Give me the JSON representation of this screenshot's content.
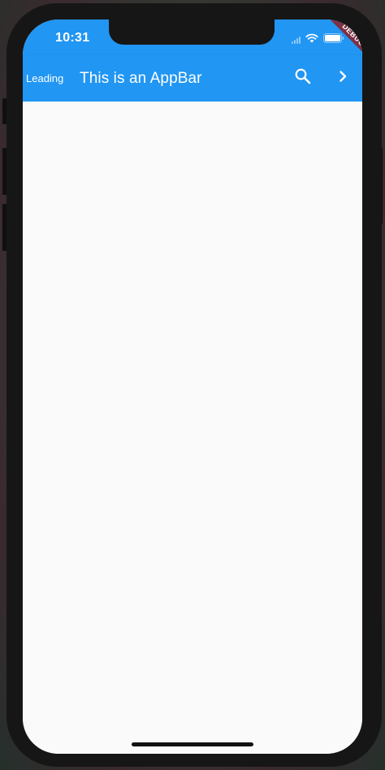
{
  "status_bar": {
    "time": "10:31",
    "icons": [
      "cellular-signal-icon",
      "wifi-icon",
      "battery-icon"
    ]
  },
  "app_bar": {
    "leading": "Leading",
    "title": "This is an AppBar",
    "actions": [
      {
        "icon": "search-icon"
      },
      {
        "icon": "chevron-right-icon"
      }
    ],
    "background_color": "#2196f3",
    "foreground_color": "#ffffff"
  },
  "debug_banner": {
    "label": "DEBUG",
    "color": "#8f1e24"
  },
  "body": {
    "background_color": "#fafafa"
  }
}
